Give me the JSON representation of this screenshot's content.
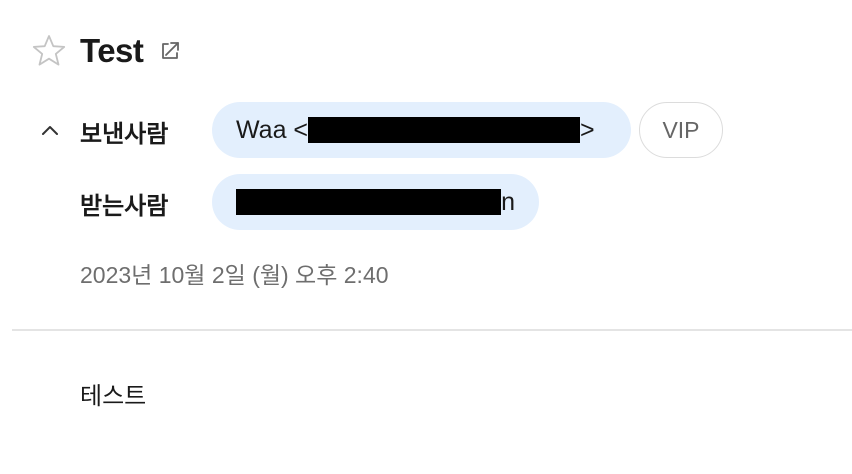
{
  "message": {
    "subject": "Test",
    "starred": false,
    "sender": {
      "label": "보낸사람",
      "name_prefix": "Waa <",
      "name_suffix": ">",
      "vip_label": "VIP"
    },
    "recipient": {
      "label": "받는사람",
      "tail_char": "n"
    },
    "date": "2023년 10월 2일 (월) 오후 2:40",
    "body": "테스트"
  },
  "icons": {
    "star": "star-outline-icon",
    "external": "open-in-new-window-icon",
    "collapse": "chevron-up-icon"
  },
  "colors": {
    "chip_background": "#e3effd",
    "divider": "#e4e4e4",
    "date_text": "#6e6e6e",
    "star_outline": "#c4c4c4"
  }
}
